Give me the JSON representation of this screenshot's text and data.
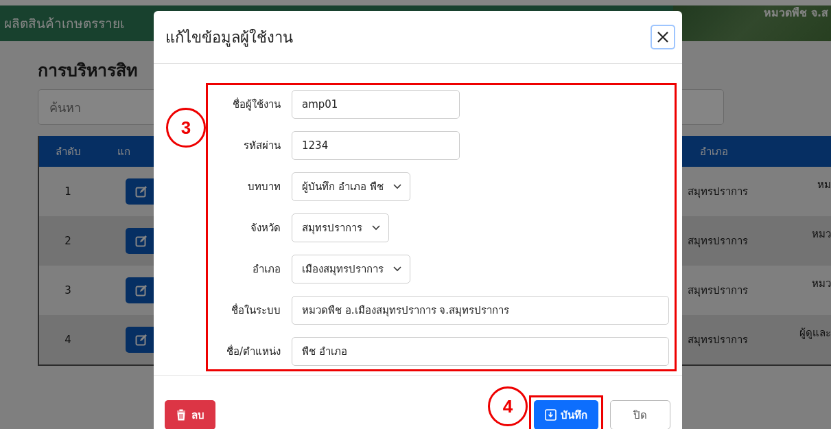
{
  "page": {
    "header_title": "ผลิตสินค้าเกษตรรายเ",
    "header_user": "หมวดพืช จ.ส",
    "title": "การบริหารสิท",
    "search": {
      "placeholder": "ค้นหา"
    },
    "table": {
      "columns": [
        "ลำดับ",
        "แก",
        "อำเภอ"
      ],
      "rows": [
        {
          "number": "1",
          "district": "สมุทรปราการ",
          "column_4": "หม"
        },
        {
          "number": "2",
          "district": "สมุทรปราการ",
          "column_4": "หมว"
        },
        {
          "number": "3",
          "district": "สมุทรปราการ",
          "column_4": "หมว"
        },
        {
          "number": "4",
          "district": "สมุทรปราการ",
          "column_4": "ผู้ดูและ"
        }
      ]
    }
  },
  "modal": {
    "title": "แก้ไขข้อมูลผู้ใช้งาน",
    "fields": [
      {
        "label": "ชื่อผู้ใช้งาน",
        "kind": "short",
        "value": "amp01"
      },
      {
        "label": "รหัสผ่าน",
        "kind": "short",
        "value": "1234"
      },
      {
        "label": "บทบาท",
        "kind": "select",
        "value": "ผู้บันทึก อำเภอ พืช"
      },
      {
        "label": "จังหวัด",
        "kind": "select",
        "value": "สมุทรปราการ"
      },
      {
        "label": "อำเภอ",
        "kind": "select",
        "value": "เมืองสมุทรปราการ"
      },
      {
        "label": "ชื่อในระบบ",
        "kind": "wide",
        "value": "หมวดพืช อ.เมืองสมุทรปราการ จ.สมุทรปราการ"
      },
      {
        "label": "ชื่อ/ตำแหน่ง",
        "kind": "wide",
        "value": "พืช อำเภอ"
      }
    ],
    "buttons": [
      {
        "label": "ลบ",
        "kind": "danger"
      },
      {
        "label": "บันทึก",
        "kind": "primary"
      },
      {
        "label": "ปิด",
        "kind": "secondary"
      }
    ]
  },
  "annotations": [
    {
      "label": "3"
    },
    {
      "label": "4"
    }
  ]
}
